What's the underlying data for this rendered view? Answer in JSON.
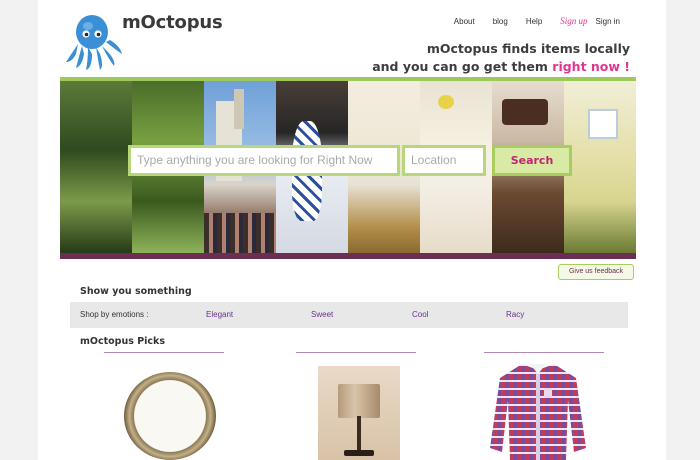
{
  "brand": {
    "name": "mOctopus"
  },
  "nav": {
    "about": "About",
    "blog": "blog",
    "help": "Help",
    "signup": "Sign up",
    "signin": "Sign in"
  },
  "tagline": {
    "line1": "mOctopus finds items locally",
    "line2_prefix": "and you can go get them ",
    "line2_highlight": "right now !"
  },
  "search": {
    "query_placeholder": "Type anything you are looking for Right Now",
    "location_placeholder": "Location",
    "button_label": "Search"
  },
  "feedback_label": "Give us feedback",
  "show_section": {
    "title": "Show you something",
    "emotions_label": "Shop by emotions :",
    "emotions": [
      "Elegant",
      "Sweet",
      "Cool",
      "Racy"
    ]
  },
  "picks": {
    "title": "mOctopus Picks"
  },
  "colors": {
    "accent_green": "#9dc85b",
    "accent_pink": "#e0368f",
    "hero_bar": "#6b2f54",
    "emotion_link": "#6b2f8e"
  }
}
